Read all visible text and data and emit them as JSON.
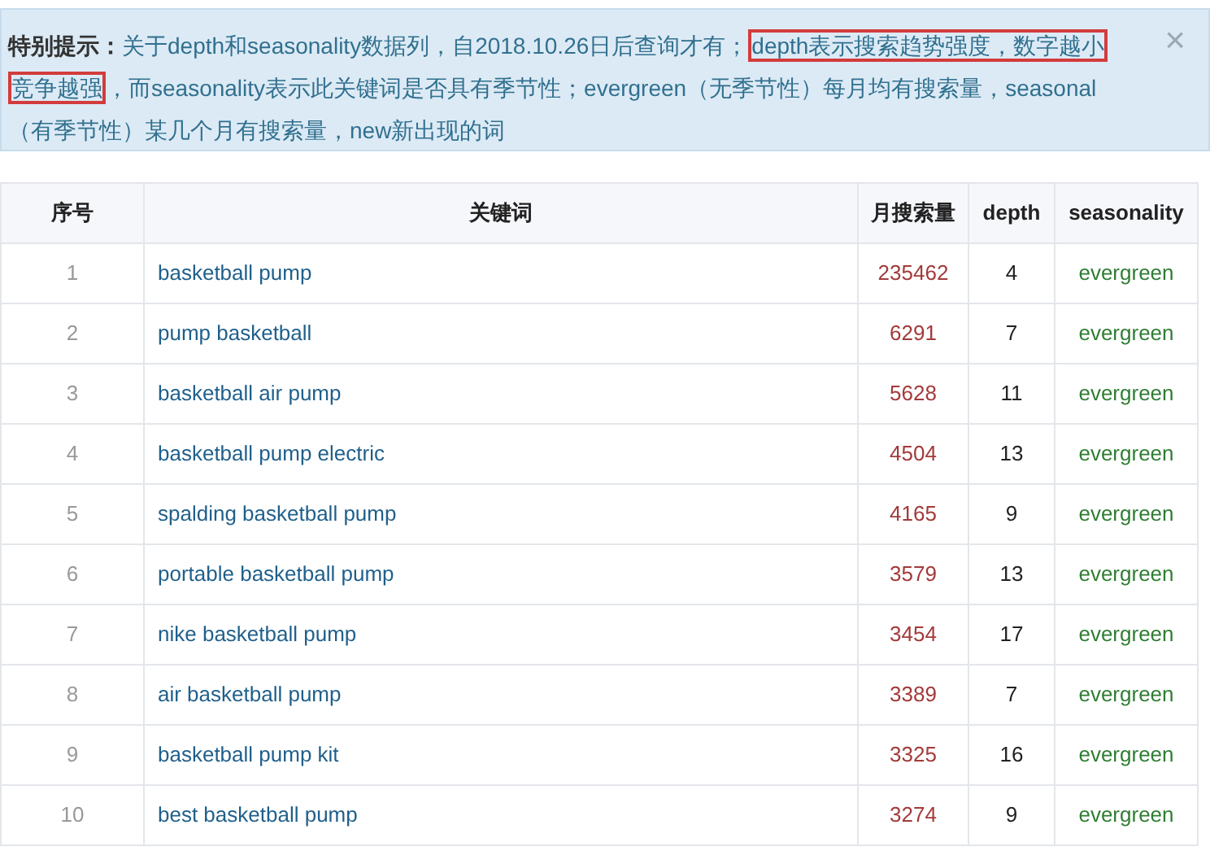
{
  "notice": {
    "label": "特别提示：",
    "segments": [
      {
        "text": "关于depth和seasonality数据列，自2018.10.26日后查询才有；",
        "highlighted": false
      },
      {
        "text": "depth表示搜索趋势强度，数字越小",
        "highlighted": true
      },
      {
        "text": "竞争越强",
        "highlighted": true
      },
      {
        "text": "，而seasonality表示此关键词是否具有季节性；evergreen（无季节性）每月均有搜索量，seasonal（有季节性）某几个月有搜索量，new新出现的词",
        "highlighted": false
      }
    ],
    "close": "×"
  },
  "table": {
    "columns": [
      "序号",
      "关键词",
      "月搜索量",
      "depth",
      "seasonality"
    ],
    "rows": [
      [
        "1",
        "basketball pump",
        "235462",
        "4",
        "evergreen"
      ],
      [
        "2",
        "pump basketball",
        "6291",
        "7",
        "evergreen"
      ],
      [
        "3",
        "basketball air pump",
        "5628",
        "11",
        "evergreen"
      ],
      [
        "4",
        "basketball pump electric",
        "4504",
        "13",
        "evergreen"
      ],
      [
        "5",
        "spalding basketball pump",
        "4165",
        "9",
        "evergreen"
      ],
      [
        "6",
        "portable basketball pump",
        "3579",
        "13",
        "evergreen"
      ],
      [
        "7",
        "nike basketball pump",
        "3454",
        "17",
        "evergreen"
      ],
      [
        "8",
        "air basketball pump",
        "3389",
        "7",
        "evergreen"
      ],
      [
        "9",
        "basketball pump kit",
        "3325",
        "16",
        "evergreen"
      ],
      [
        "10",
        "best basketball pump",
        "3274",
        "9",
        "evergreen"
      ]
    ]
  }
}
